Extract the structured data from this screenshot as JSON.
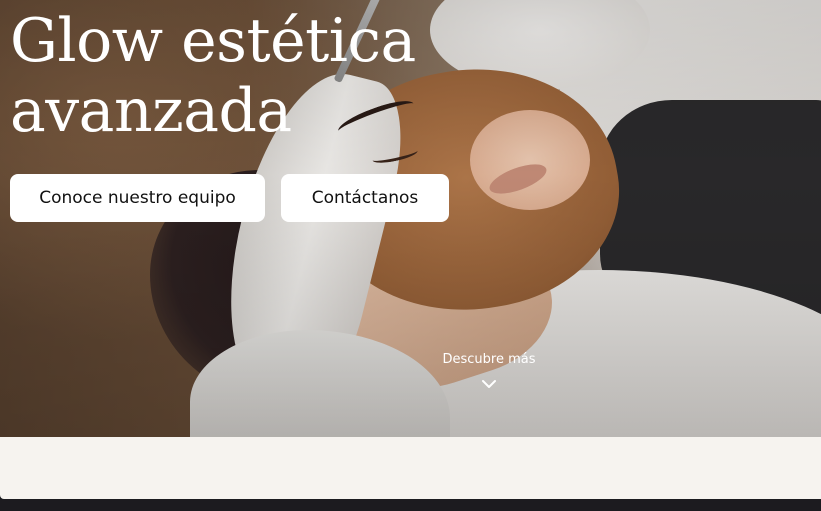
{
  "hero": {
    "title_line1": "Glow estética",
    "title_line2": "avanzada",
    "image_icon": "hero-photo-facial-treatment"
  },
  "actions": {
    "team_label": "Conoce nuestro equipo",
    "contact_label": "Contáctanos"
  },
  "discover": {
    "label": "Descubre más",
    "icon": "chevron-down-icon"
  },
  "colors": {
    "button_bg": "#ffffff",
    "button_text": "#111111",
    "band_bg": "#f6f3ef",
    "footer_bg": "#1c1b1f",
    "headline_text": "#ffffff"
  }
}
